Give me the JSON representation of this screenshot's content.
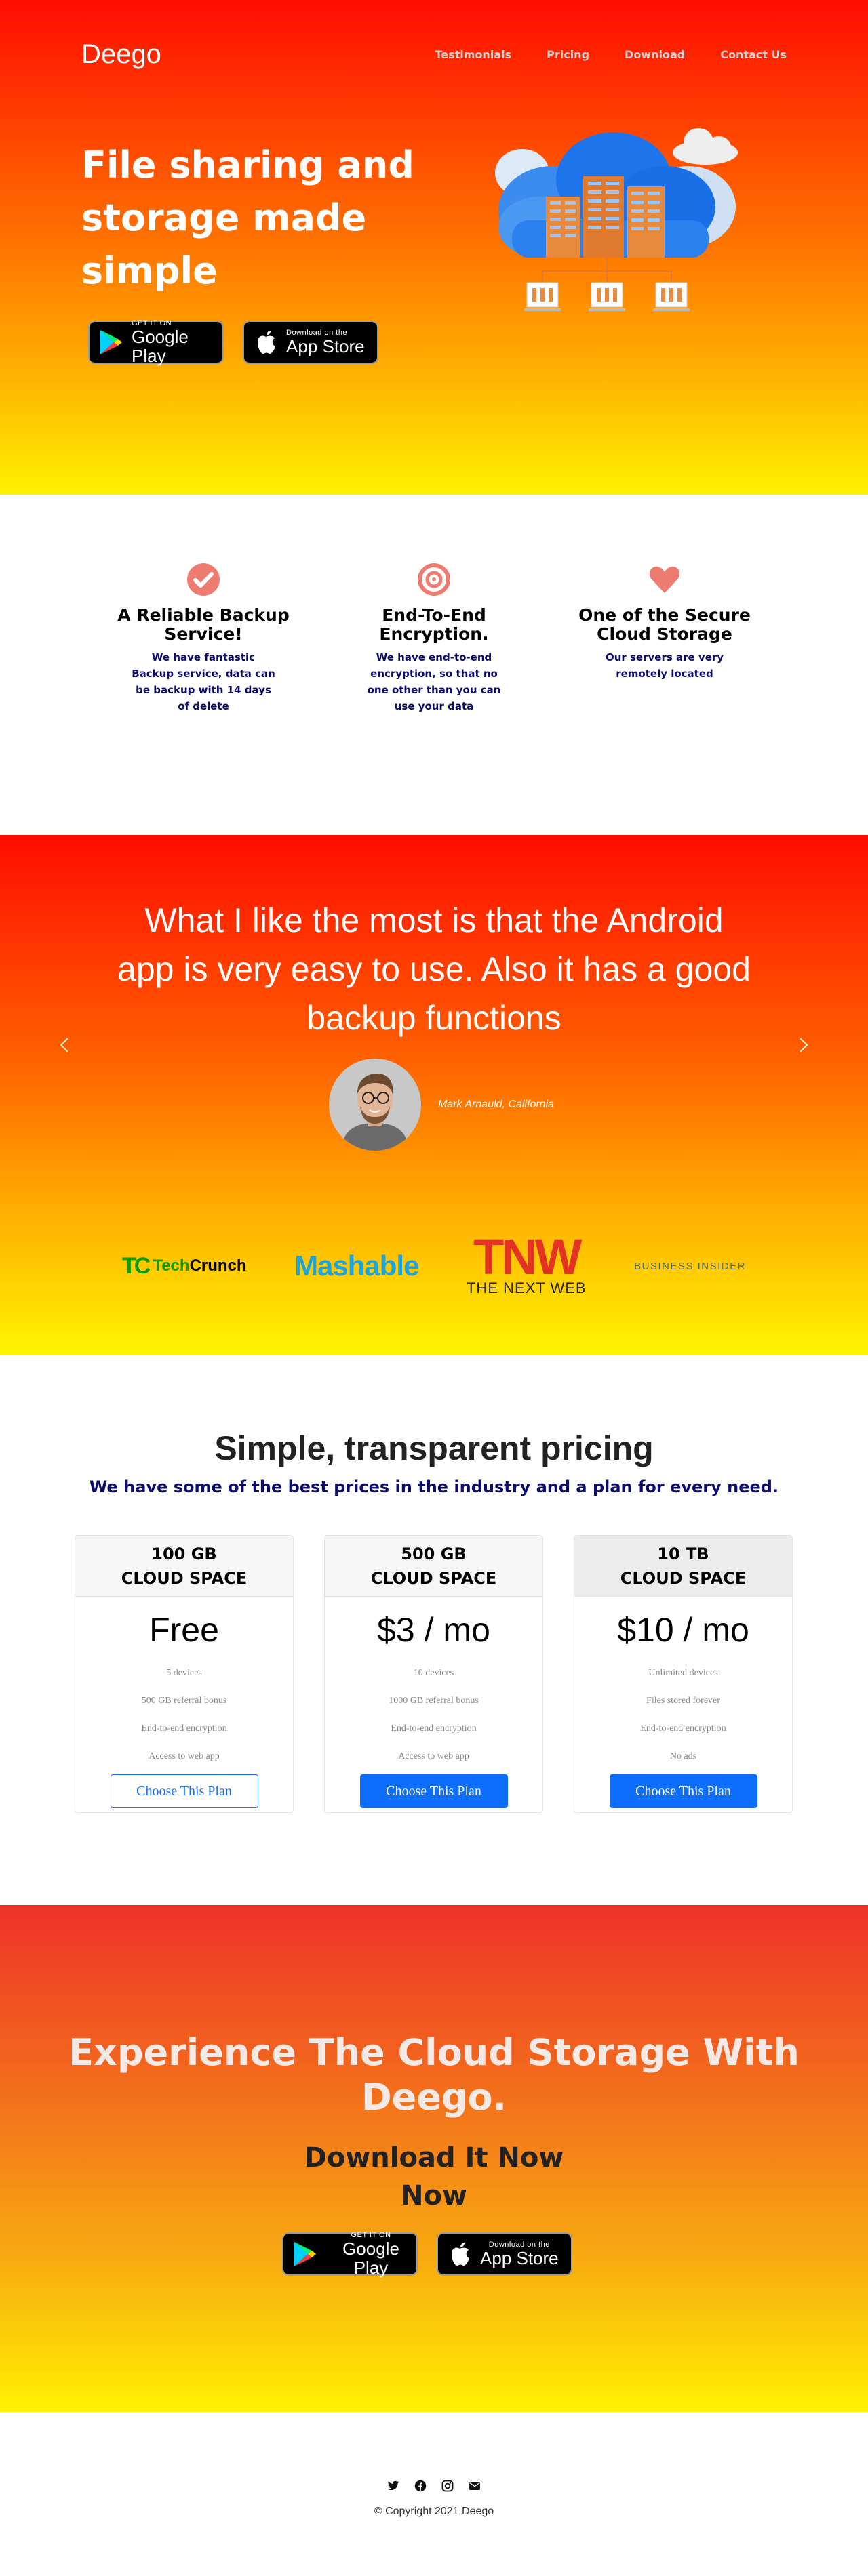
{
  "nav": {
    "brand": "Deego",
    "links": [
      "Testimonials",
      "Pricing",
      "Download",
      "Contact Us"
    ]
  },
  "hero": {
    "title": "File sharing and storage made simple"
  },
  "stores": {
    "google_small": "GET IT ON",
    "google_big": "Google Play",
    "apple_small": "Download on the",
    "apple_big": "App Store"
  },
  "features": [
    {
      "icon": "check-circle-icon",
      "title": "A Reliable Backup Service!",
      "text": "We have fantastic Backup service, data can be backup with 14 days of delete"
    },
    {
      "icon": "target-icon",
      "title": "End-To-End Encryption.",
      "text": "We have end-to-end encryption, so that no one other than you can use your data"
    },
    {
      "icon": "heart-icon",
      "title": "One of the Secure Cloud Storage",
      "text": "Our servers are very remotely located"
    }
  ],
  "testimonial": {
    "quote": "What I like the most is that the Android app is very easy to use. Also it has a good backup functions",
    "author": "Mark Arnauld, California"
  },
  "press": {
    "techcrunch_tech": "Tech",
    "techcrunch_crunch": "Crunch",
    "mashable": "Mashable",
    "tnw_big": "TNW",
    "tnw_small": "THE NEXT WEB",
    "business_insider": "BUSINESS INSIDER"
  },
  "pricing": {
    "title": "Simple, transparent pricing",
    "subtitle": "We have some of the best prices in the industry and a plan for every need.",
    "plans": [
      {
        "size": "100 GB",
        "space": "CLOUD SPACE",
        "price": "Free",
        "features": [
          "5 devices",
          "500 GB referral bonus",
          "End-to-end encryption",
          "Access to web app"
        ],
        "button": "Choose This Plan"
      },
      {
        "size": "500 GB",
        "space": "CLOUD SPACE",
        "price": "$3 / mo",
        "features": [
          "10 devices",
          "1000 GB referral bonus",
          "End-to-end encryption",
          "Access to web app"
        ],
        "button": "Choose This Plan"
      },
      {
        "size": "10 TB",
        "space": "CLOUD SPACE",
        "price": "$10 / mo",
        "features": [
          "Unlimited devices",
          "Files stored forever",
          "End-to-end encryption",
          "No ads"
        ],
        "button": "Choose This Plan"
      }
    ]
  },
  "cta": {
    "title": "Experience The Cloud Storage With Deego.",
    "subtitle": "Download It Now Now"
  },
  "footer": {
    "social": [
      "twitter-icon",
      "facebook-icon",
      "instagram-icon",
      "envelope-icon"
    ],
    "copyright": "© Copyright 2021 Deego"
  },
  "colors": {
    "accent_blue": "#0d6efd",
    "navy_text": "#0b0b6e",
    "feature_icon": "#ee7b6f"
  }
}
